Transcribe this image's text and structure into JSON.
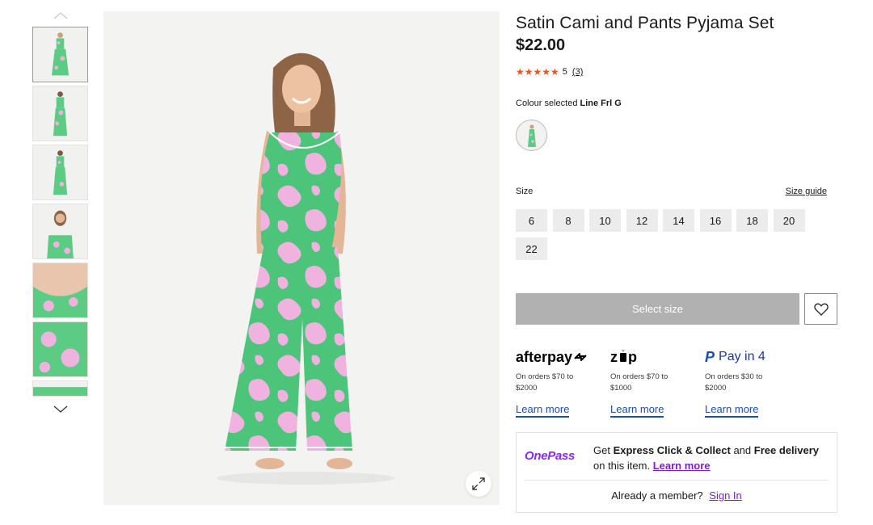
{
  "product": {
    "title": "Satin Cami and Pants Pyjama Set",
    "price": "$22.00",
    "stars": "★★★★★",
    "rating_value": "5",
    "rating_count": "(3)",
    "colour_prefix": "Colour selected",
    "colour_name": "Line Frl G"
  },
  "sizes": {
    "label": "Size",
    "guide_label": "Size guide",
    "options": [
      "6",
      "8",
      "10",
      "12",
      "14",
      "16",
      "18",
      "20",
      "22"
    ]
  },
  "actions": {
    "select_size_label": "Select size",
    "wishlist_icon": "heart-icon"
  },
  "payments": [
    {
      "logo": "afterpay",
      "text": "On orders $70 to $2000",
      "link": "Learn more"
    },
    {
      "logo": "zip",
      "text": "On orders $70 to $1000",
      "link": "Learn more"
    },
    {
      "logo": "Pay in 4",
      "text": "On orders $30 to $2000",
      "link": "Learn more"
    }
  ],
  "onepass": {
    "logo": "OnePass",
    "text_get": "Get",
    "express": "Express Click & Collect",
    "and": "and",
    "free": "Free delivery",
    "on_item": "on this item.",
    "learn_more": "Learn more",
    "member_text": "Already a member?",
    "sign_in": "Sign In"
  },
  "colors": {
    "accent_purple": "#7b1fd1",
    "star_orange": "#e05a1f",
    "pyjama_green": "#4cc47a",
    "pyjama_pink": "#f0b3e0"
  }
}
